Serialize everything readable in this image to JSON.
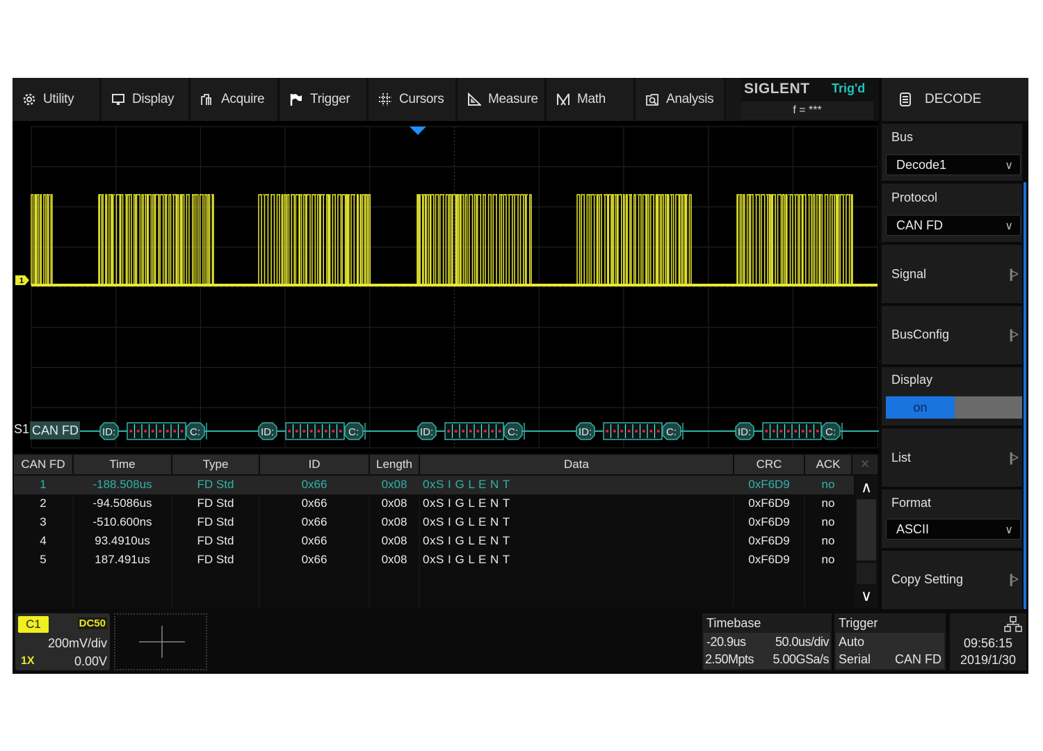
{
  "menubar": {
    "items": [
      {
        "label": "Utility",
        "icon": "gear-icon"
      },
      {
        "label": "Display",
        "icon": "monitor-icon"
      },
      {
        "label": "Acquire",
        "icon": "acquire-icon"
      },
      {
        "label": "Trigger",
        "icon": "flag-icon"
      },
      {
        "label": "Cursors",
        "icon": "cursors-icon"
      },
      {
        "label": "Measure",
        "icon": "ruler-triangle-icon"
      },
      {
        "label": "Math",
        "icon": "math-icon"
      },
      {
        "label": "Analysis",
        "icon": "analysis-icon"
      }
    ]
  },
  "brand": {
    "logo": "SIGLENT",
    "trigger_status": "Trig'd",
    "frequency": "f = ***"
  },
  "side_panel": {
    "title": "DECODE",
    "bus_label": "Bus",
    "bus_value": "Decode1",
    "protocol_label": "Protocol",
    "protocol_value": "CAN FD",
    "signal_label": "Signal",
    "busconfig_label": "BusConfig",
    "display_label": "Display",
    "display_on": "on",
    "display_state": true,
    "list_label": "List",
    "format_label": "Format",
    "format_value": "ASCII",
    "copy_setting_label": "Copy Setting",
    "submenu_glyph": "||>"
  },
  "waveform": {
    "channel_marker": "1",
    "channel_color": "#e8e830",
    "decode_color": "#2fb3a8",
    "trigger_marker_color": "#1e90ff",
    "bus_label": "S1",
    "bus_protocol": "CAN FD",
    "frames": [
      {
        "id_label": "ID:",
        "crc_label": "C:"
      },
      {
        "id_label": "ID:",
        "crc_label": "C:"
      },
      {
        "id_label": "ID:",
        "crc_label": "C:"
      },
      {
        "id_label": "ID:",
        "crc_label": "C:"
      },
      {
        "id_label": "ID:",
        "crc_label": "C:"
      }
    ]
  },
  "decode_table": {
    "headers": [
      "CAN FD",
      "Time",
      "Type",
      "ID",
      "Length",
      "Data",
      "CRC",
      "ACK"
    ],
    "selected_row": 0,
    "highlight_color": "#2fb3a8",
    "rows": [
      {
        "num": "1",
        "time": "-188.508us",
        "type": "FD Std",
        "id": "0x66",
        "length": "0x08",
        "data": "0xS I G L E N T",
        "crc": "0xF6D9",
        "ack": "no"
      },
      {
        "num": "2",
        "time": "-94.5086us",
        "type": "FD Std",
        "id": "0x66",
        "length": "0x08",
        "data": "0xS I G L E N T",
        "crc": "0xF6D9",
        "ack": "no"
      },
      {
        "num": "3",
        "time": "-510.600ns",
        "type": "FD Std",
        "id": "0x66",
        "length": "0x08",
        "data": "0xS I G L E N T",
        "crc": "0xF6D9",
        "ack": "no"
      },
      {
        "num": "4",
        "time": "93.4910us",
        "type": "FD Std",
        "id": "0x66",
        "length": "0x08",
        "data": "0xS I G L E N T",
        "crc": "0xF6D9",
        "ack": "no"
      },
      {
        "num": "5",
        "time": "187.491us",
        "type": "FD Std",
        "id": "0x66",
        "length": "0x08",
        "data": "0xS I G L E N T",
        "crc": "0xF6D9",
        "ack": "no"
      }
    ]
  },
  "status_bar": {
    "channel": {
      "name": "C1",
      "coupling": "DC50",
      "scale": "200mV/div",
      "probe": "1X",
      "offset": "0.00V"
    },
    "timebase": {
      "label": "Timebase",
      "delay": "-20.9us",
      "scale": "50.0us/div",
      "memory": "2.50Mpts",
      "sample_rate": "5.00GSa/s"
    },
    "trigger": {
      "label": "Trigger",
      "mode": "Auto",
      "type": "Serial",
      "source": "CAN FD"
    },
    "clock": {
      "time": "09:56:15",
      "date": "2019/1/30"
    }
  }
}
